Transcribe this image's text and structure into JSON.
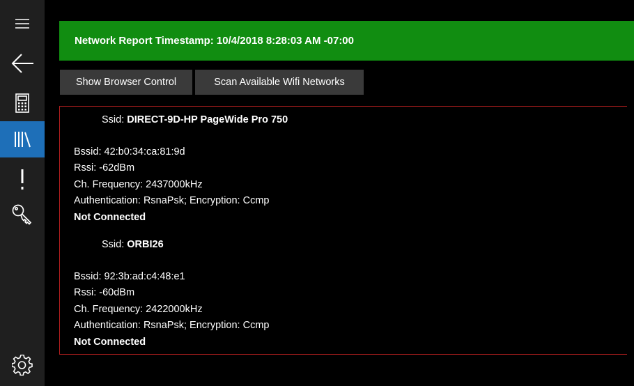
{
  "sidebar": {
    "items": [
      {
        "icon": "hamburger-menu-icon"
      },
      {
        "icon": "back-arrow-icon"
      },
      {
        "icon": "calculator-icon"
      },
      {
        "icon": "library-icon",
        "active": true
      },
      {
        "icon": "exclamation-icon"
      },
      {
        "icon": "key-icon"
      },
      {
        "icon": "gear-icon"
      }
    ]
  },
  "header": {
    "text": "Network Report Timestamp: 10/4/2018 8:28:03 AM -07:00",
    "color": "#118d11"
  },
  "toolbar": {
    "show_browser_label": "Show Browser Control",
    "scan_wifi_label": "Scan Available Wifi Networks"
  },
  "networks": [
    {
      "ssid_label": "Ssid:",
      "ssid": "DIRECT-9D-HP PageWide Pro 750",
      "bssid": "Bssid: 42:b0:34:ca:81:9d",
      "rssi": "Rssi: -62dBm",
      "frequency": "Ch. Frequency: 2437000kHz",
      "security": "Authentication: RsnaPsk; Encryption: Ccmp",
      "status": "Not Connected"
    },
    {
      "ssid_label": "Ssid:",
      "ssid": "ORBI26",
      "bssid": "Bssid: 92:3b:ad:c4:48:e1",
      "rssi": "Rssi: -60dBm",
      "frequency": "Ch. Frequency: 2422000kHz",
      "security": "Authentication: RsnaPsk; Encryption: Ccmp",
      "status": "Not Connected"
    }
  ],
  "colors": {
    "accent": "#1e6fb8",
    "border": "#b41f1f",
    "button_bg": "#3a3a3a"
  }
}
